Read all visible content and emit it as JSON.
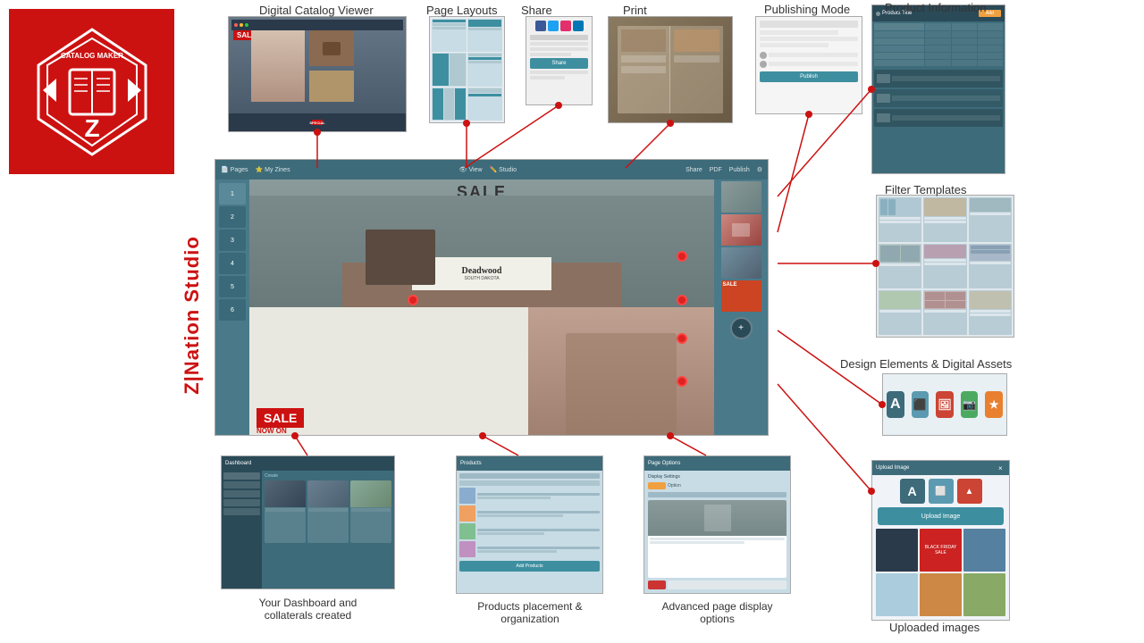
{
  "app": {
    "title": "ZINation Studio",
    "logo_text": "CATALOG MAKER"
  },
  "vertical_label": "Z|Nation Studio",
  "features": {
    "digital_catalog_viewer": {
      "label": "Digital Catalog Viewer",
      "position": "top-left"
    },
    "page_layouts": {
      "label": "Page Layouts"
    },
    "share": {
      "label": "Share"
    },
    "print": {
      "label": "Print"
    },
    "publishing_mode": {
      "label": "Publishing Mode"
    },
    "product_information": {
      "label": "Product Information"
    },
    "filter_templates": {
      "label": "Filter Templates"
    },
    "design_elements": {
      "label": "Design Elements & Digital Assets"
    },
    "uploaded_images": {
      "label": "Uploaded images"
    },
    "dashboard": {
      "label": "Your Dashboard and\ncollaterals created"
    },
    "products_placement": {
      "label": "Products placement &\norganization"
    },
    "advanced_page": {
      "label": "Advanced page display\noptions"
    }
  },
  "editor": {
    "toolbar_items": [
      "Pages",
      "My Zines",
      "View",
      "Studio",
      "Share",
      "PDF",
      "Publish"
    ],
    "page_numbers": [
      "1",
      "2",
      "3",
      "4",
      "5",
      "6"
    ],
    "sale_text": "SALE",
    "sale_now_on": "SALE\nNOW ON"
  },
  "colors": {
    "primary_red": "#cc1111",
    "primary_teal": "#3d6b7a",
    "light_teal": "#4a7a8a",
    "connector_red": "#dd2222",
    "bg_gray": "#f0f4f5"
  }
}
